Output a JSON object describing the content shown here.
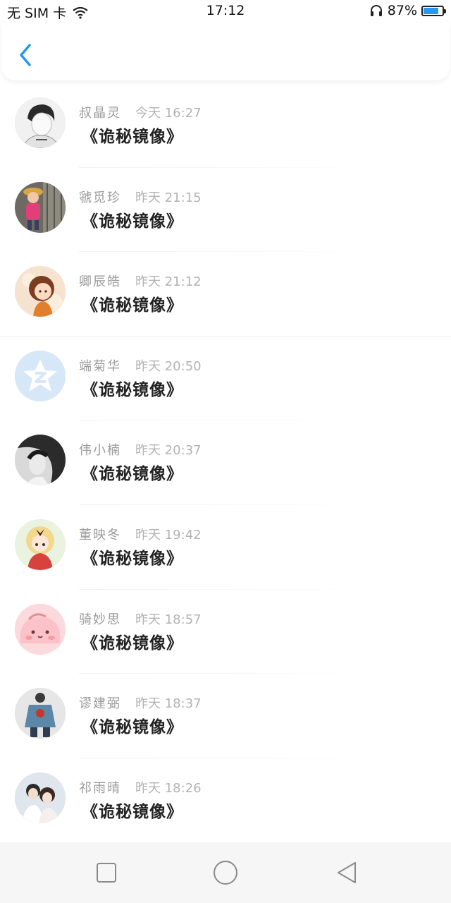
{
  "status_bar": {
    "carrier": "无 SIM 卡",
    "time": "17:12",
    "battery": "87%",
    "battery_level": 0.87
  },
  "header": {
    "back_icon": "chevron-left-icon",
    "accent_color": "#2196f3"
  },
  "messages": [
    {
      "name": "叔晶灵",
      "time": "今天 16:27",
      "title": "《诡秘镜像》",
      "avatar": "avatar-ink-portrait"
    },
    {
      "name": "虢觅珍",
      "time": "昨天 21:15",
      "title": "《诡秘镜像》",
      "avatar": "avatar-child-pink"
    },
    {
      "name": "卿辰皓",
      "time": "昨天 21:12",
      "title": "《诡秘镜像》",
      "avatar": "avatar-cartoon-girl"
    },
    {
      "name": "端菊华",
      "time": "昨天 20:50",
      "title": "《诡秘镜像》",
      "avatar": "avatar-qzone-default"
    },
    {
      "name": "伟小楠",
      "time": "昨天 20:37",
      "title": "《诡秘镜像》",
      "avatar": "avatar-bw-man"
    },
    {
      "name": "董映冬",
      "time": "昨天 19:42",
      "title": "《诡秘镜像》",
      "avatar": "avatar-anime-blonde"
    },
    {
      "name": "骑妙思",
      "time": "昨天 18:57",
      "title": "《诡秘镜像》",
      "avatar": "avatar-pink-blob"
    },
    {
      "name": "谬建弼",
      "time": "昨天 18:37",
      "title": "《诡秘镜像》",
      "avatar": "avatar-denim-jacket"
    },
    {
      "name": "祁雨晴",
      "time": "昨天 18:26",
      "title": "《诡秘镜像》",
      "avatar": "avatar-couple"
    }
  ],
  "nav_bar": {
    "recent_icon": "square-icon",
    "home_icon": "circle-icon",
    "back_icon": "triangle-back-icon"
  }
}
